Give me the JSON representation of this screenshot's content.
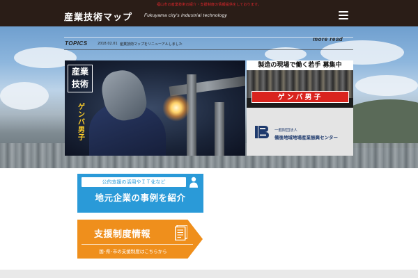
{
  "header": {
    "sub_text": "福山市の産業技術の紹介・支援制度の情報提供をしております。",
    "logo": "産業技術マップ",
    "logo_en": "Fukuyama city's Industrial technology"
  },
  "topics": {
    "label": "TOPICS",
    "date": "2018.02.01",
    "text": "産業技術マップをリニューアルしました",
    "more": "more read"
  },
  "hero": {
    "welder_title": "産業技術",
    "welder_vertical": "ゲンバ男子",
    "recruit_heading": "製造の現場で働く若手 募集中",
    "recruit_badge": "ゲンバ男子",
    "foundation_small": "一般財団法人",
    "foundation_name": "備後地域地場産業振興センター"
  },
  "banners": {
    "blue_sub": "公的支援の活用やＩＴ化など",
    "blue_main": "地元企業の事例を紹介",
    "orange_main": "支援制度情報",
    "orange_sub": "国･県･市の支援制度はこちらから"
  },
  "colors": {
    "header_bg": "#2a1d17",
    "accent_red": "#e0262c",
    "banner_blue": "#2a9ad8",
    "banner_orange": "#ef8f1c",
    "foundation_blue": "#1e3a6d"
  }
}
